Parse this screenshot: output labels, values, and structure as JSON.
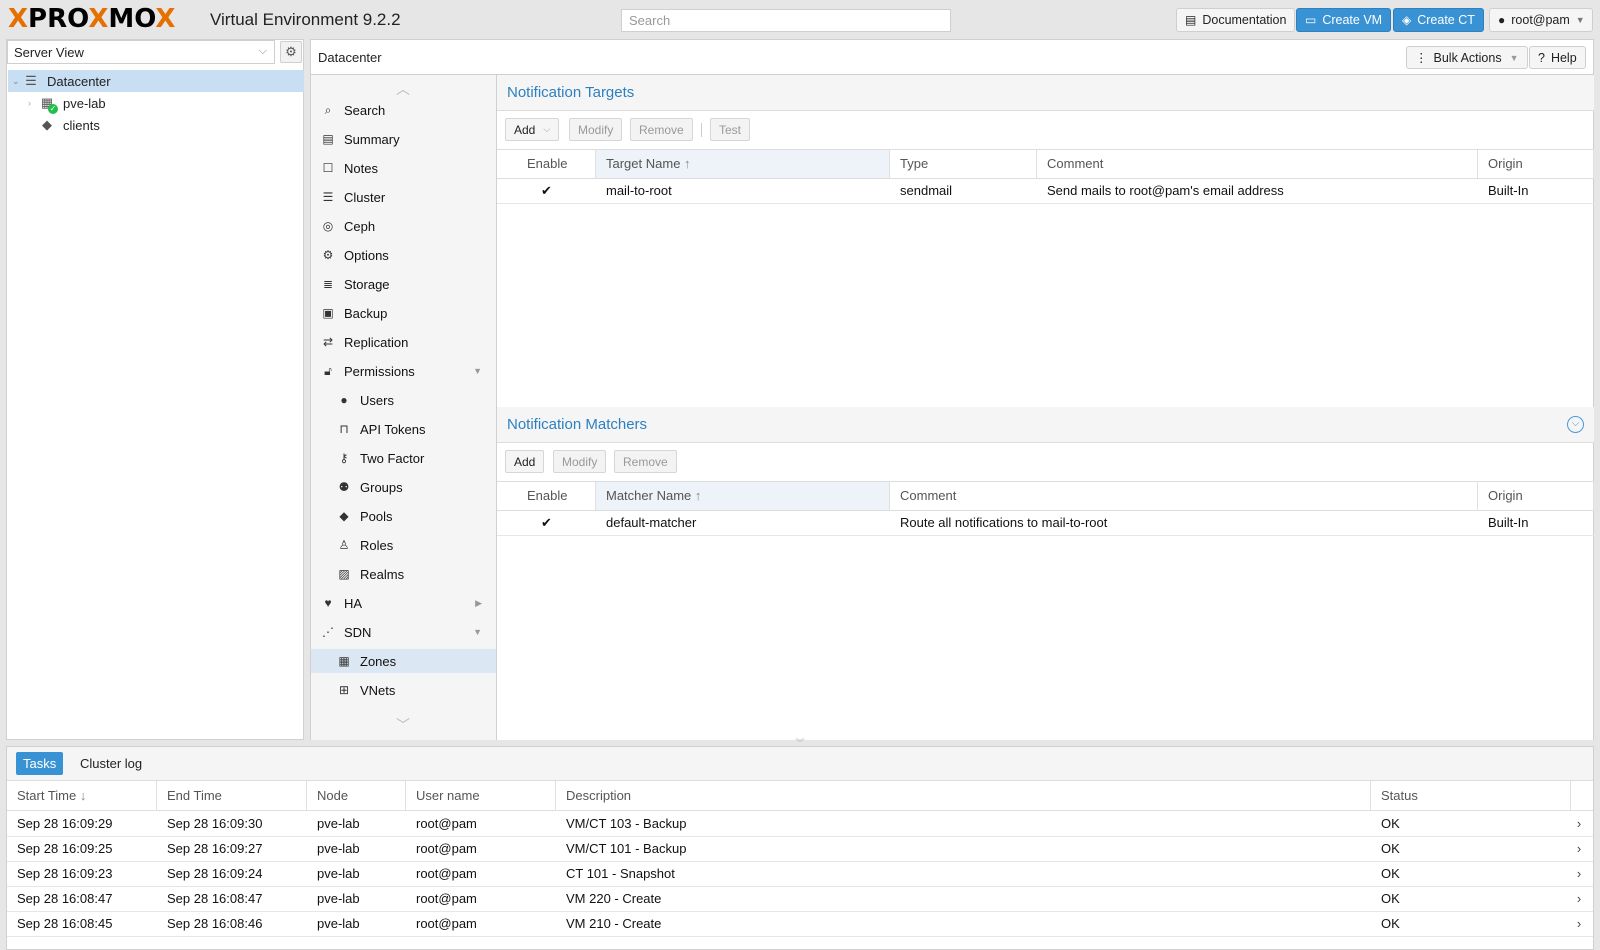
{
  "brand": {
    "logo": "PROXMOX",
    "product": "Virtual Environment 9.2.2",
    "search_placeholder": "Search"
  },
  "topbar": {
    "documentation": "Documentation",
    "create_vm": "Create VM",
    "create_ct": "Create CT",
    "user": "root@pam",
    "accent_color": "#3892d4"
  },
  "tree": {
    "view": "Server View",
    "nodes": [
      {
        "label": "Datacenter",
        "icon": "server-stack-icon",
        "selected": true
      },
      {
        "label": "pve-lab",
        "icon": "node-online-icon"
      },
      {
        "label": "clients",
        "icon": "tags-icon"
      }
    ]
  },
  "header": {
    "title": "Datacenter",
    "bulk_actions": "Bulk Actions",
    "help": "Help"
  },
  "menu": {
    "items": [
      {
        "label": "Search",
        "icon": "search-icon"
      },
      {
        "label": "Summary",
        "icon": "book-icon"
      },
      {
        "label": "Notes",
        "icon": "note-icon"
      },
      {
        "label": "Cluster",
        "icon": "server-stack-icon"
      },
      {
        "label": "Ceph",
        "icon": "ceph-icon"
      },
      {
        "label": "Options",
        "icon": "gear-icon"
      },
      {
        "label": "Storage",
        "icon": "database-icon"
      },
      {
        "label": "Backup",
        "icon": "floppy-icon"
      },
      {
        "label": "Replication",
        "icon": "retweet-icon"
      },
      {
        "label": "Permissions",
        "icon": "unlock-icon"
      },
      {
        "label": "Users",
        "icon": "user-icon"
      },
      {
        "label": "API Tokens",
        "icon": "lock-icon"
      },
      {
        "label": "Two Factor",
        "icon": "key-icon"
      },
      {
        "label": "Groups",
        "icon": "users-icon"
      },
      {
        "label": "Pools",
        "icon": "tags-icon"
      },
      {
        "label": "Roles",
        "icon": "male-icon"
      },
      {
        "label": "Realms",
        "icon": "address-book-icon"
      },
      {
        "label": "HA",
        "icon": "heartbeat-icon"
      },
      {
        "label": "SDN",
        "icon": "sdn-icon"
      },
      {
        "label": "Zones",
        "icon": "grid-icon",
        "selected": true
      },
      {
        "label": "VNets",
        "icon": "sitemap-icon"
      }
    ]
  },
  "targets": {
    "title": "Notification Targets",
    "buttons": {
      "add": "Add",
      "modify": "Modify",
      "remove": "Remove",
      "test": "Test"
    },
    "columns": [
      "Enable",
      "Target Name",
      "Type",
      "Comment",
      "Origin"
    ],
    "rows": [
      {
        "enable": "✔",
        "name": "mail-to-root",
        "type": "sendmail",
        "comment": "Send mails to root@pam's email address",
        "origin": "Built-In"
      }
    ]
  },
  "matchers": {
    "title": "Notification Matchers",
    "buttons": {
      "add": "Add",
      "modify": "Modify",
      "remove": "Remove"
    },
    "columns": [
      "Enable",
      "Matcher Name",
      "Comment",
      "Origin"
    ],
    "rows": [
      {
        "enable": "✔",
        "name": "default-matcher",
        "comment": "Route all notifications to mail-to-root",
        "origin": "Built-In"
      }
    ]
  },
  "tasks": {
    "tabs": [
      "Tasks",
      "Cluster log"
    ],
    "columns": [
      "Start Time",
      "End Time",
      "Node",
      "User name",
      "Description",
      "Status"
    ],
    "rows": [
      {
        "start": "Sep 28 16:09:29",
        "end": "Sep 28 16:09:30",
        "node": "pve-lab",
        "user": "root@pam",
        "desc": "VM/CT 103 - Backup",
        "status": "OK"
      },
      {
        "start": "Sep 28 16:09:25",
        "end": "Sep 28 16:09:27",
        "node": "pve-lab",
        "user": "root@pam",
        "desc": "VM/CT 101 - Backup",
        "status": "OK"
      },
      {
        "start": "Sep 28 16:09:23",
        "end": "Sep 28 16:09:24",
        "node": "pve-lab",
        "user": "root@pam",
        "desc": "CT 101 - Snapshot",
        "status": "OK"
      },
      {
        "start": "Sep 28 16:08:47",
        "end": "Sep 28 16:08:47",
        "node": "pve-lab",
        "user": "root@pam",
        "desc": "VM 220 - Create",
        "status": "OK"
      },
      {
        "start": "Sep 28 16:08:45",
        "end": "Sep 28 16:08:46",
        "node": "pve-lab",
        "user": "root@pam",
        "desc": "VM 210 - Create",
        "status": "OK"
      }
    ]
  }
}
